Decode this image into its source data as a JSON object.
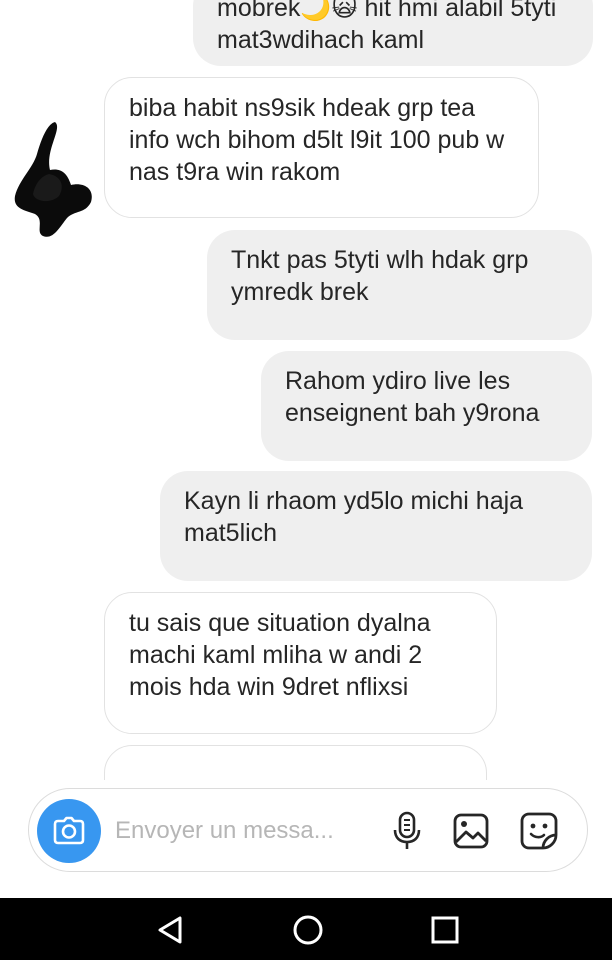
{
  "conversation": {
    "messages": [
      {
        "direction": "sent",
        "text": "mobrek🌙🙀 hit hmi alabil 5tyti mat3wdihach kaml"
      },
      {
        "direction": "received",
        "text": "biba habit ns9sik hdeak grp tea info wch bihom d5lt l9it 100 pub w nas t9ra win rakom"
      },
      {
        "direction": "sent",
        "text": "Tnkt pas 5tyti wlh hdak grp ymredk brek"
      },
      {
        "direction": "sent",
        "text": "Rahom ydiro live les enseignent bah y9rona"
      },
      {
        "direction": "sent",
        "text": "Kayn li rhaom yd5lo michi haja mat5lich"
      },
      {
        "direction": "received",
        "text": "tu sais que situation dyalna machi kaml mliha w andi 2 mois hda win 9dret nflixsi"
      },
      {
        "direction": "received",
        "text": ""
      }
    ]
  },
  "composer": {
    "placeholder": "Envoyer un messa...",
    "value": "",
    "accent_color": "#3897f0",
    "icons": [
      "camera-icon",
      "microphone-icon",
      "gallery-icon",
      "sticker-icon"
    ]
  },
  "system_nav": {
    "buttons": [
      "back",
      "home",
      "recents"
    ]
  }
}
